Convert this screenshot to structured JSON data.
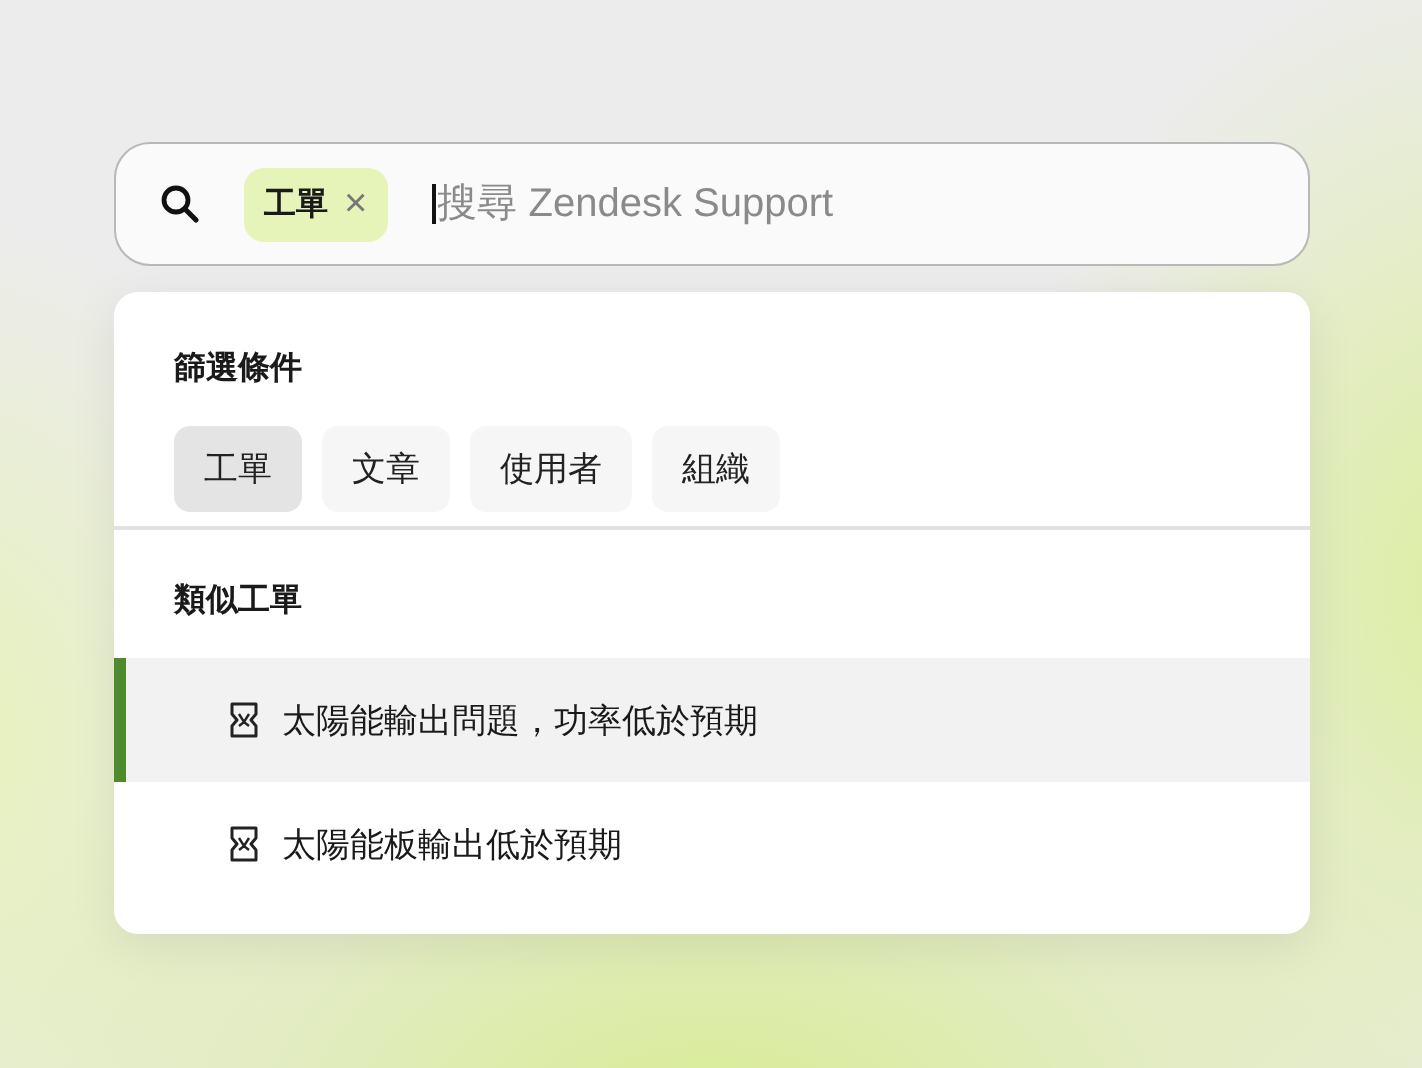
{
  "search": {
    "token": {
      "label": "工單",
      "remove_symbol": "×"
    },
    "placeholder": "搜尋 Zendesk Support"
  },
  "filters": {
    "title": "篩選條件",
    "items": [
      {
        "label": "工單",
        "selected": true
      },
      {
        "label": "文章",
        "selected": false
      },
      {
        "label": "使用者",
        "selected": false
      },
      {
        "label": "組織",
        "selected": false
      }
    ]
  },
  "similar": {
    "title": "類似工單",
    "items": [
      {
        "label": "太陽能輸出問題，功率低於預期",
        "selected": true
      },
      {
        "label": "太陽能板輸出低於預期",
        "selected": false
      }
    ]
  }
}
